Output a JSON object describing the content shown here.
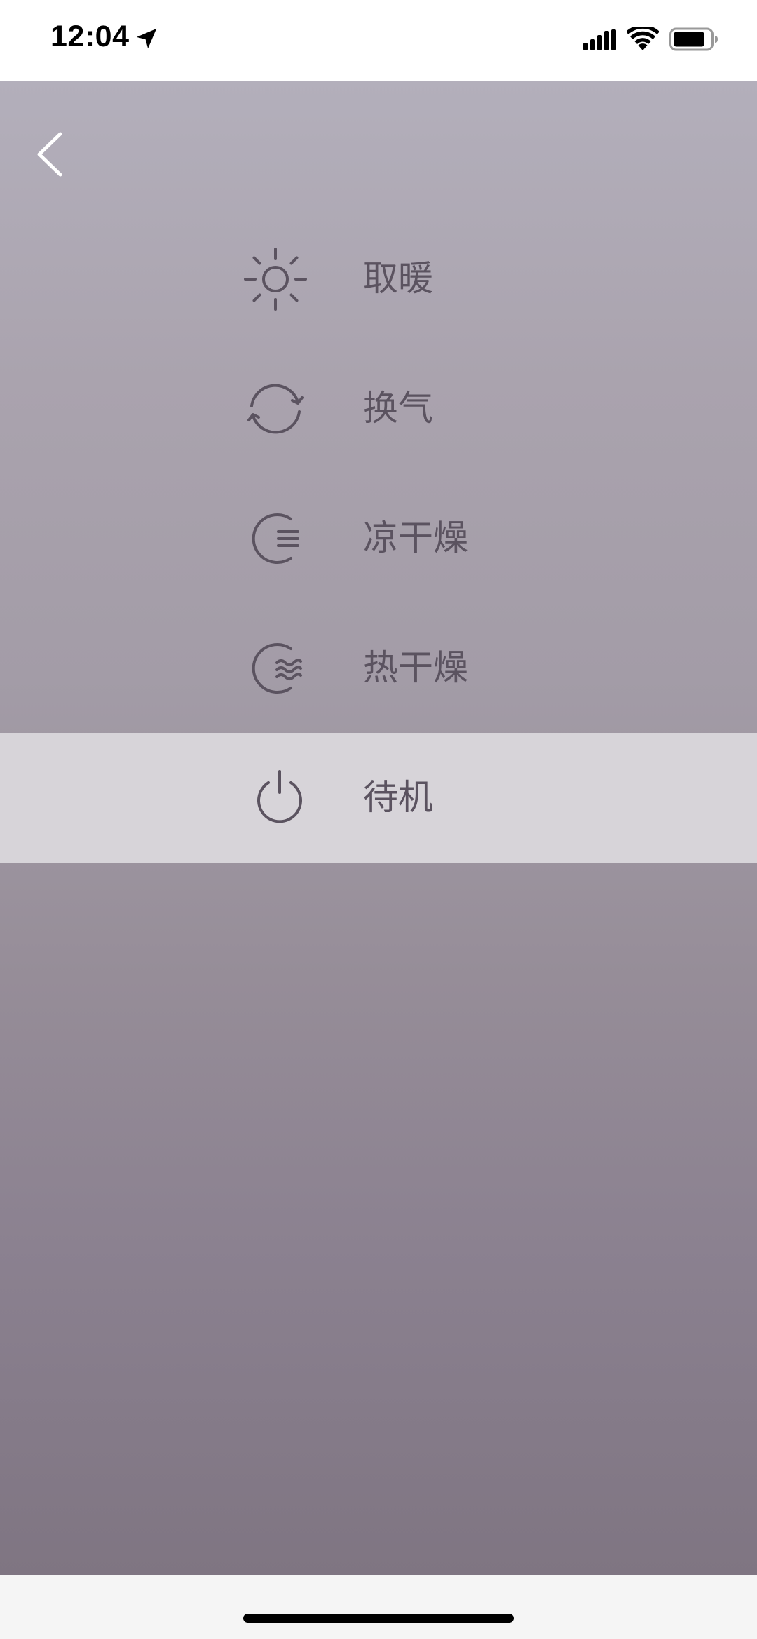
{
  "status_bar": {
    "time": "12:04",
    "icons": [
      "location-arrow-icon",
      "cellular-signal-icon",
      "wifi-icon",
      "battery-icon"
    ]
  },
  "nav": {
    "back_icon": "chevron-left-icon"
  },
  "modes": [
    {
      "label": "取暖",
      "icon": "sun-icon",
      "selected": false
    },
    {
      "label": "换气",
      "icon": "refresh-cycle-icon",
      "selected": false
    },
    {
      "label": "凉干燥",
      "icon": "cool-dry-icon",
      "selected": false
    },
    {
      "label": "热干燥",
      "icon": "hot-dry-icon",
      "selected": false
    },
    {
      "label": "待机",
      "icon": "power-icon",
      "selected": true
    }
  ],
  "colors": {
    "icon_stroke": "#5b5360",
    "label_text": "#5b5360",
    "selected_row_bg": "#d7d4d9",
    "back_arrow": "#ffffff"
  }
}
